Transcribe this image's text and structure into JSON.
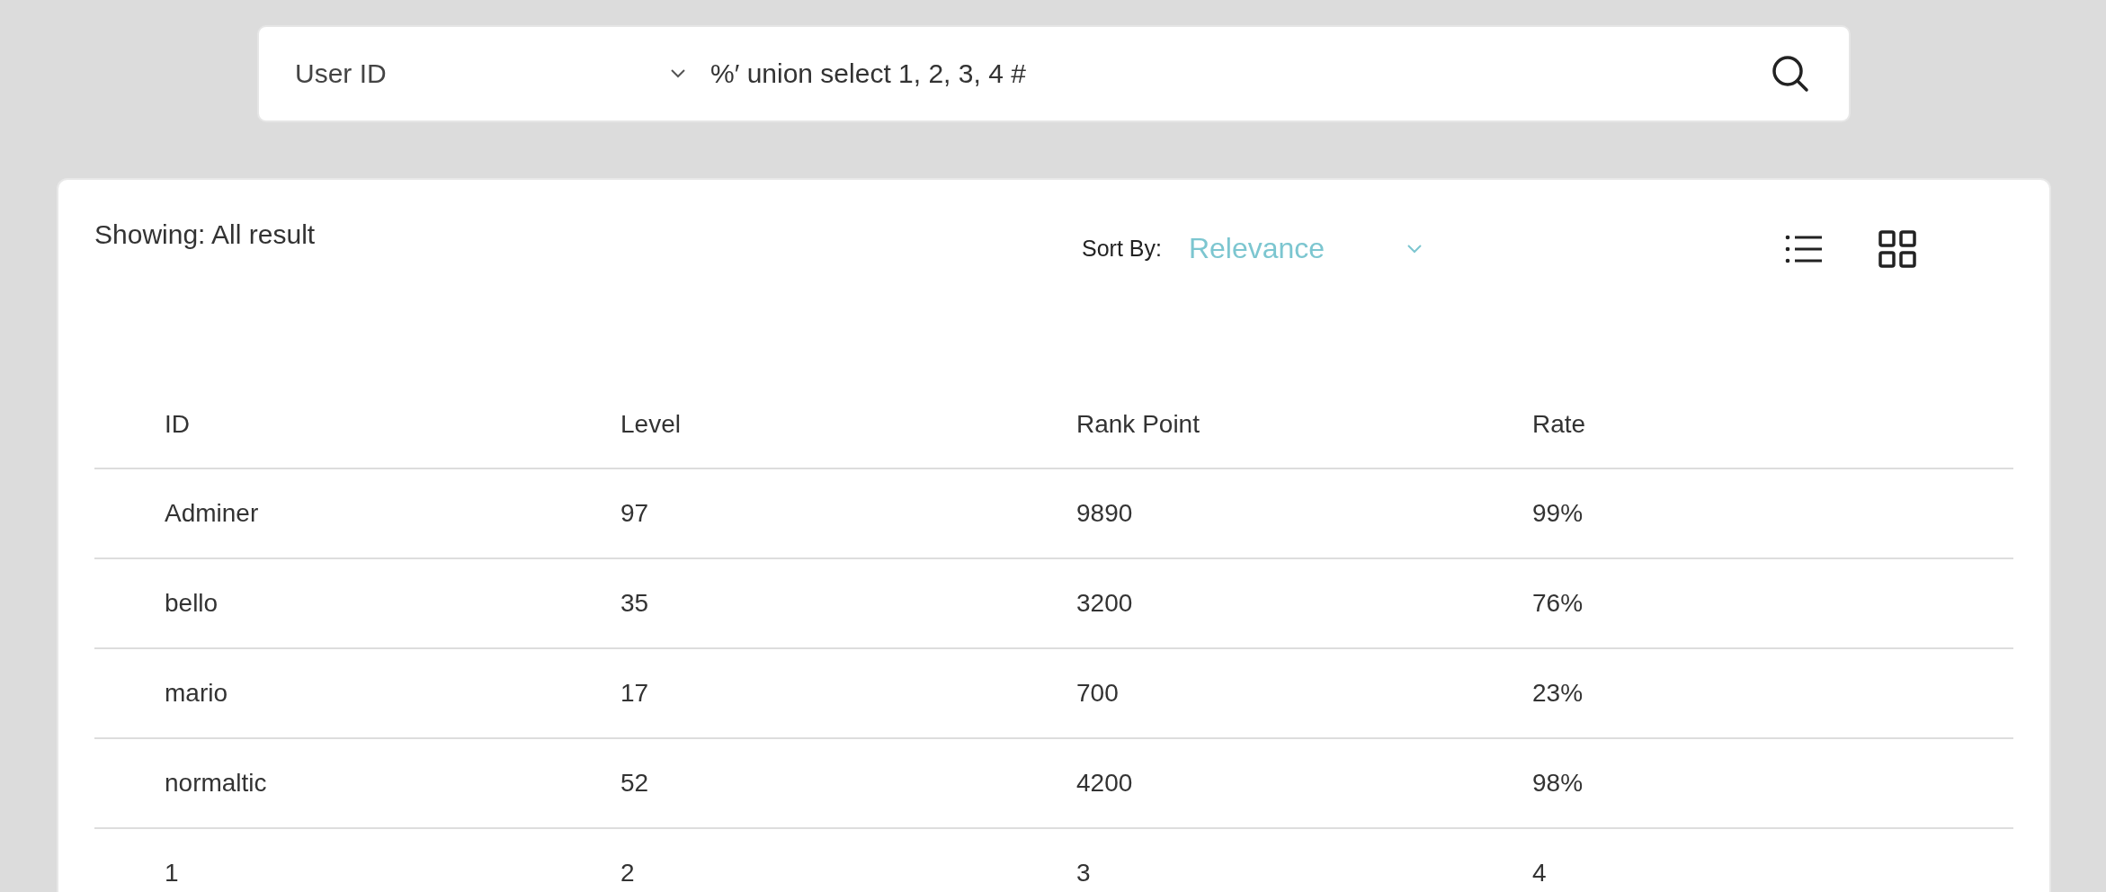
{
  "search": {
    "field_select": "User ID",
    "query": "%′ union select 1, 2, 3, 4 #"
  },
  "results": {
    "showing": "Showing: All result",
    "sort_label": "Sort By:",
    "sort_value": "Relevance",
    "table": {
      "columns": [
        "ID",
        "Level",
        "Rank Point",
        "Rate"
      ],
      "rows": [
        [
          "Adminer",
          "97",
          "9890",
          "99%"
        ],
        [
          "bello",
          "35",
          "3200",
          "76%"
        ],
        [
          "mario",
          "17",
          "700",
          "23%"
        ],
        [
          "normaltic",
          "52",
          "4200",
          "98%"
        ],
        [
          "1",
          "2",
          "3",
          "4"
        ]
      ]
    }
  }
}
